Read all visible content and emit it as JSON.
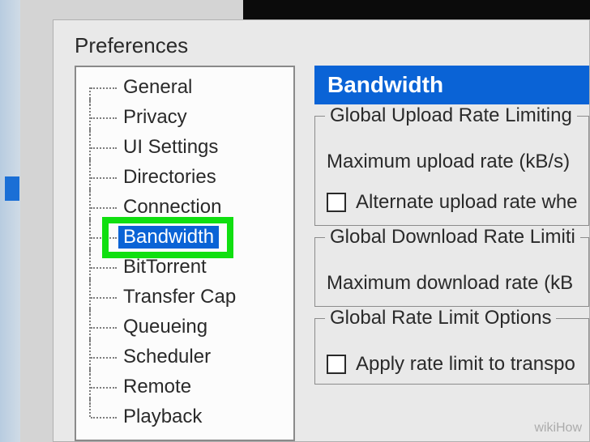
{
  "dialog": {
    "title": "Preferences"
  },
  "tree": {
    "items": [
      {
        "label": "General",
        "selected": false
      },
      {
        "label": "Privacy",
        "selected": false
      },
      {
        "label": "UI Settings",
        "selected": false
      },
      {
        "label": "Directories",
        "selected": false
      },
      {
        "label": "Connection",
        "selected": false
      },
      {
        "label": "Bandwidth",
        "selected": true
      },
      {
        "label": "BitTorrent",
        "selected": false
      },
      {
        "label": "Transfer Cap",
        "selected": false
      },
      {
        "label": "Queueing",
        "selected": false
      },
      {
        "label": "Scheduler",
        "selected": false
      },
      {
        "label": "Remote",
        "selected": false
      },
      {
        "label": "Playback",
        "selected": false
      }
    ]
  },
  "panel": {
    "header": "Bandwidth",
    "group_upload": {
      "title": "Global Upload Rate Limiting",
      "max_label": "Maximum upload rate (kB/s)",
      "alt_checkbox_label": "Alternate upload rate whe"
    },
    "group_download": {
      "title": "Global Download Rate Limiti",
      "max_label": "Maximum download rate (kB"
    },
    "group_options": {
      "title": "Global Rate Limit Options",
      "apply_checkbox_label": "Apply rate limit to transpo"
    }
  },
  "watermark": "wikiHow"
}
